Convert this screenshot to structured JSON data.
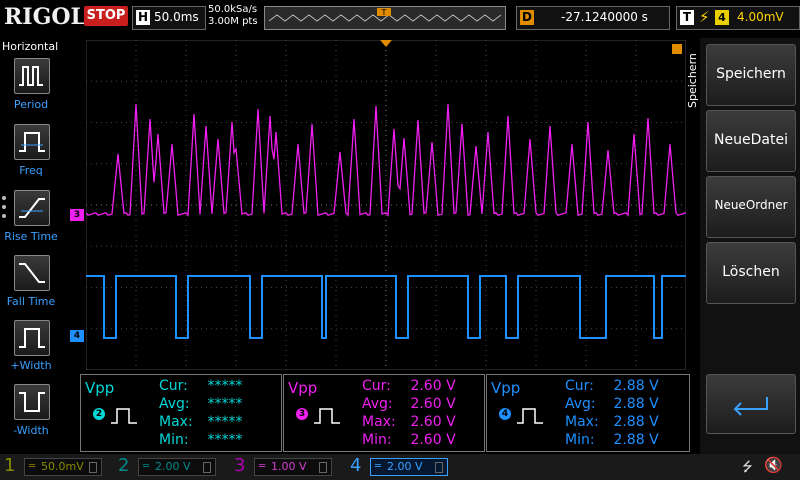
{
  "brand": "RIGOL",
  "run_state": "STOP",
  "horizontal": {
    "label": "H",
    "timebase": "50.0ms"
  },
  "acquisition": {
    "sample_rate": "50.0kSa/s",
    "memory_depth": "3.00M pts"
  },
  "delay": {
    "label": "D",
    "value": "-27.1240000 s"
  },
  "trigger": {
    "label": "T",
    "source": "4",
    "level": "4.00mV"
  },
  "left_menu": {
    "title": "Horizontal",
    "items": [
      {
        "label": "Period",
        "icon": "period-icon"
      },
      {
        "label": "Freq",
        "icon": "freq-icon"
      },
      {
        "label": "Rise Time",
        "icon": "rise-time-icon"
      },
      {
        "label": "Fall Time",
        "icon": "fall-time-icon"
      },
      {
        "label": "+Width",
        "icon": "positive-width-icon"
      },
      {
        "label": "-Width",
        "icon": "negative-width-icon"
      }
    ]
  },
  "right_menu": {
    "title": "Speichern",
    "items": [
      {
        "label": "Speichern"
      },
      {
        "label": "NeueDatei"
      },
      {
        "label": "NeueOrdner"
      },
      {
        "label": "Löschen"
      }
    ],
    "back_icon": "return-arrow-icon"
  },
  "markers": {
    "ch3": "3",
    "ch4": "4"
  },
  "measurements": [
    {
      "channel": "2",
      "title": "Vpp",
      "color": "#00d8d8",
      "rows": [
        {
          "k": "Cur:",
          "v": "*****"
        },
        {
          "k": "Avg:",
          "v": "*****"
        },
        {
          "k": "Max:",
          "v": "*****"
        },
        {
          "k": "Min:",
          "v": "*****"
        }
      ]
    },
    {
      "channel": "3",
      "title": "Vpp",
      "color": "#f020f0",
      "rows": [
        {
          "k": "Cur:",
          "v": "2.60 V"
        },
        {
          "k": "Avg:",
          "v": "2.60 V"
        },
        {
          "k": "Max:",
          "v": "2.60 V"
        },
        {
          "k": "Min:",
          "v": "2.60 V"
        }
      ]
    },
    {
      "channel": "4",
      "title": "Vpp",
      "color": "#1e90ff",
      "rows": [
        {
          "k": "Cur:",
          "v": "2.88 V"
        },
        {
          "k": "Avg:",
          "v": "2.88 V"
        },
        {
          "k": "Max:",
          "v": "2.88 V"
        },
        {
          "k": "Min:",
          "v": "2.88 V"
        }
      ]
    }
  ],
  "channels": [
    {
      "num": "1",
      "scale": "50.0mV",
      "color": "#8a8a00"
    },
    {
      "num": "2",
      "scale": "2.00 V",
      "color": "#008a8a"
    },
    {
      "num": "3",
      "scale": "1.00 V",
      "color": "#b000b0"
    },
    {
      "num": "4",
      "scale": "2.00 V",
      "color": "#1e90ff"
    }
  ],
  "status_icons": [
    "usb-icon",
    "speaker-muted-icon"
  ]
}
